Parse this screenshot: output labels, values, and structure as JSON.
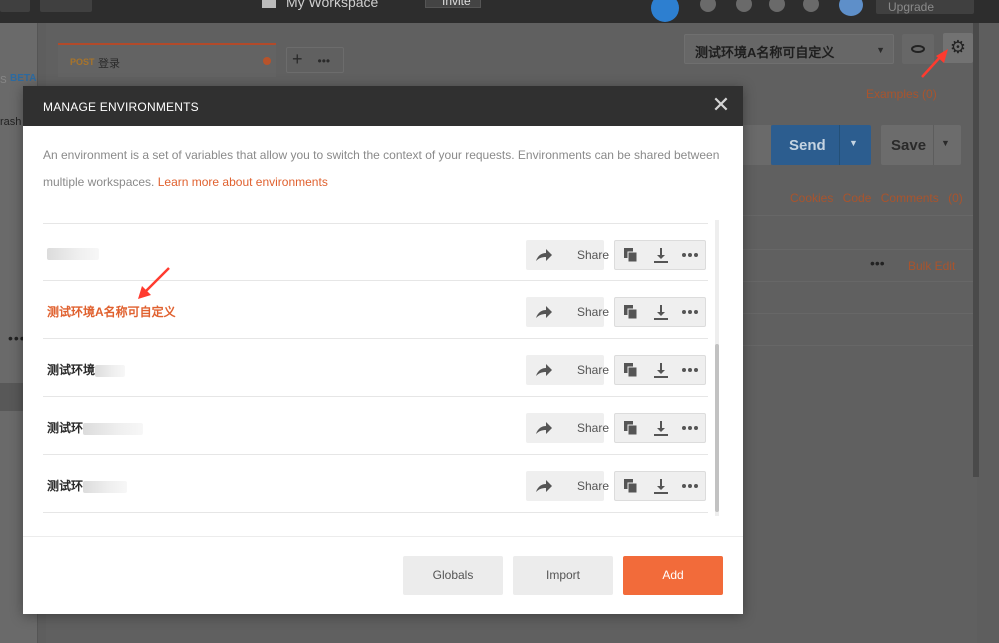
{
  "topbar": {
    "workspace": "My Workspace",
    "invite": "Invite",
    "upgrade": "Upgrade"
  },
  "sidebar": {
    "beta": "BETA",
    "beta_prefix": "S",
    "trash": "rash",
    "dots": "•••"
  },
  "request_tab": {
    "method": "POST",
    "name": "登录",
    "add": "+",
    "more": "•••"
  },
  "environment_select": {
    "value": "测试环境A名称可自定义",
    "caret": "▼"
  },
  "right_panel": {
    "examples": "Examples (0)",
    "send": "Send",
    "save": "Save",
    "cookies": "Cookies",
    "code": "Code",
    "comments": "Comments (0)",
    "bulk_edit": "Bulk Edit",
    "dots": "•••"
  },
  "modal": {
    "title": "MANAGE ENVIRONMENTS",
    "close": "✕",
    "description": "An environment is a set of variables that allow you to switch the context of your requests. Environments can be shared between multiple workspaces.",
    "learn_more": "Learn more about environments",
    "share_label": "Share",
    "environments": [
      {
        "name": "",
        "blurred": true,
        "active": false
      },
      {
        "name": "测试环境A名称可自定义",
        "blurred": false,
        "active": true
      },
      {
        "name": "测试环境",
        "blurred": true,
        "active": false
      },
      {
        "name": "测试环",
        "blurred": true,
        "active": false
      },
      {
        "name": "测试环",
        "blurred": true,
        "active": false
      }
    ],
    "footer": {
      "globals": "Globals",
      "import": "Import",
      "add": "Add"
    }
  },
  "colors": {
    "accent": "#f26b3a",
    "link": "#e0612f",
    "header_bg": "#303030",
    "send_blue": "#2c5d8f"
  },
  "icons": [
    "gear-icon",
    "eye-icon",
    "close-icon",
    "share-arrow-icon",
    "duplicate-icon",
    "download-icon",
    "more-icon",
    "plus-icon",
    "red-arrow-annotation"
  ]
}
